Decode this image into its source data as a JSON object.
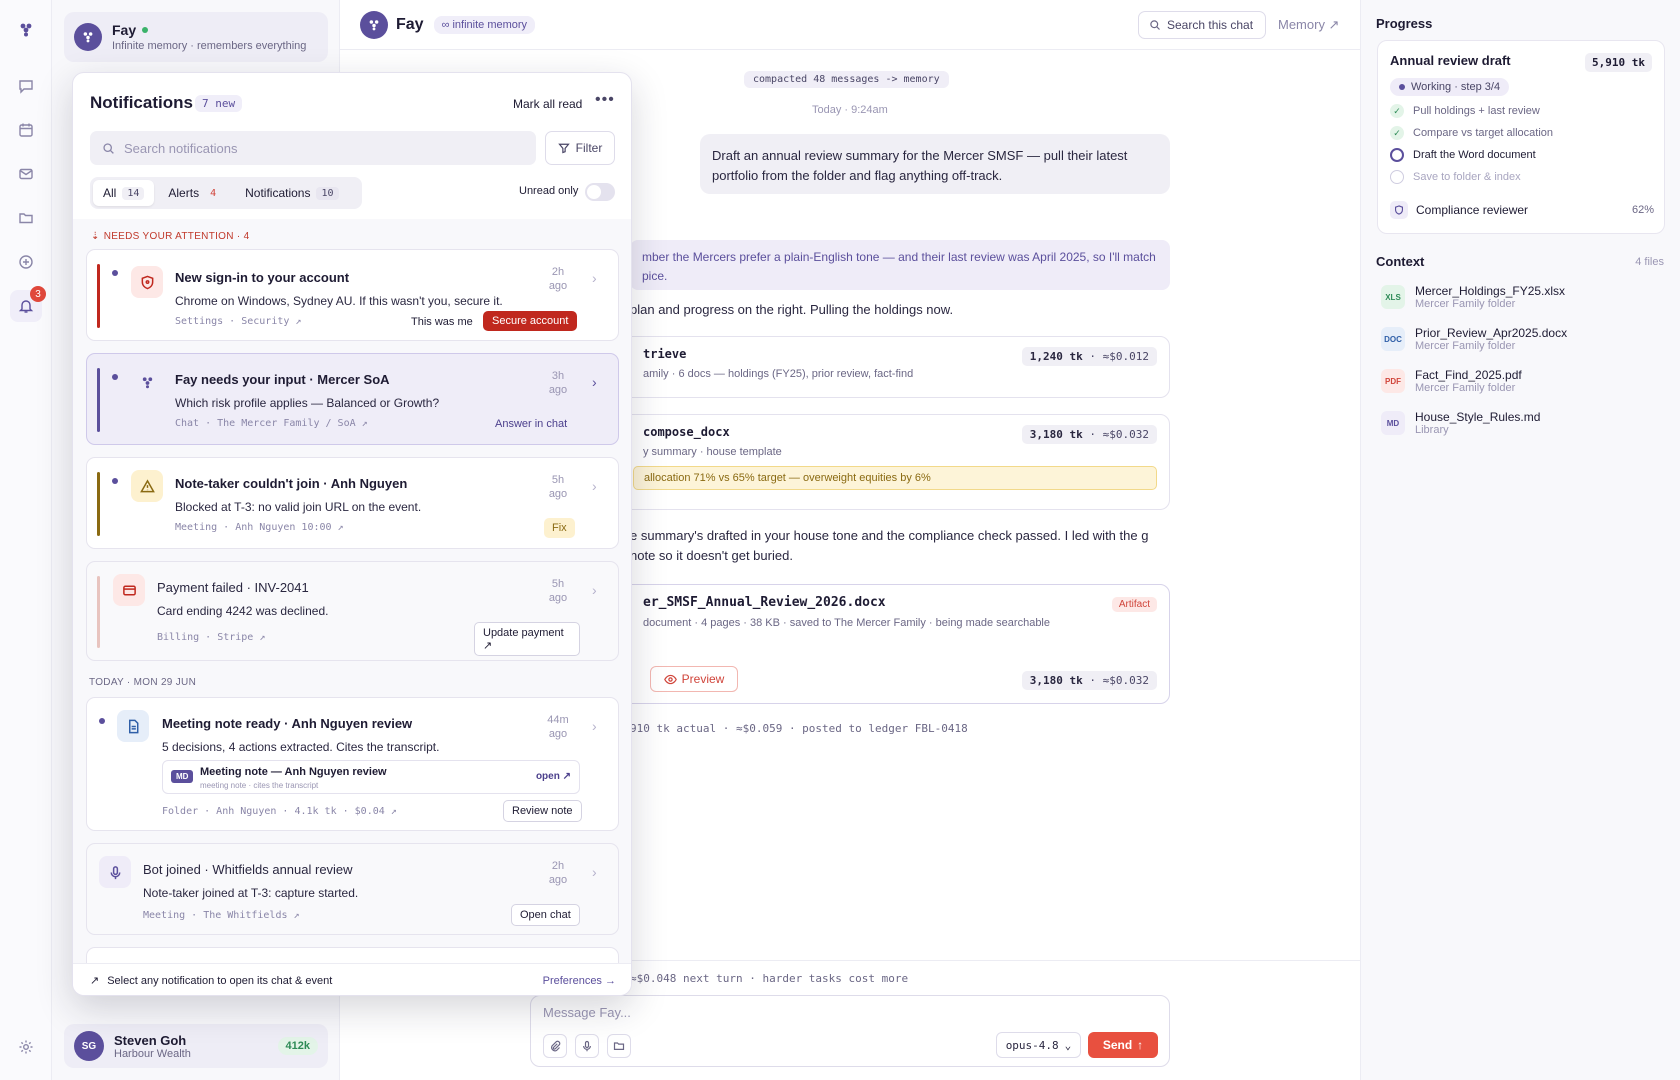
{
  "rail": {
    "notif_badge": "3"
  },
  "sidebar": {
    "agent_name": "Fay",
    "agent_sub": "Infinite memory · remembers everything",
    "user_initials": "SG",
    "user_name": "Steven Goh",
    "user_org": "Harbour Wealth",
    "credits": "412k"
  },
  "chat": {
    "title": "Fay",
    "memory_pill": "∞ infinite memory",
    "search_label": "Search this chat",
    "memory_link": "Memory ↗",
    "compacted": "compacted 48 messages -> memory",
    "timestamp": "Today · 9:24am",
    "user_message": "Draft an annual review summary for the Mercer SMSF — pull their latest portfolio from the folder and flag anything off-track.",
    "memory_note": "mber the Mercers prefer a plain-English tone — and their last review was April 2025, so I'll match pice.",
    "assist_1": "plan and progress on the right. Pulling the holdings now.",
    "tool1": {
      "name": "trieve",
      "desc": "amily · 6 docs — holdings (FY25), prior review, fact-find",
      "tk": "1,240 tk",
      "cost": "≈$0.012"
    },
    "tool2": {
      "name": "compose_docx",
      "desc": "y summary · house template",
      "tk": "3,180 tk",
      "cost": "≈$0.032",
      "warning": "allocation 71% vs 65% target — overweight equities by 6%"
    },
    "assist_2": "e summary's drafted in your house tone and the compliance check passed. I led with the g note so it doesn't get buried.",
    "artifact": {
      "name": "er_SMSF_Annual_Review_2026.docx",
      "tag": "Artifact",
      "meta": "document · 4 pages · 38 KB · saved to The Mercer Family · being made searchable",
      "preview": "Preview",
      "tk": "3,180 tk",
      "cost": "≈$0.032"
    },
    "ledger": "910 tk actual · ≈$0.059 · posted to ledger FBL-0418",
    "next_turn": "≈$0.048 next turn · harder tasks cost more",
    "composer_placeholder": "Message Fay...",
    "model": "opus-4.8",
    "send": "Send"
  },
  "progress": {
    "heading": "Progress",
    "title": "Annual review draft",
    "tk": "5,910 tk",
    "status": "Working · step 3/4",
    "steps": [
      "Pull holdings + last review",
      "Compare vs target allocation",
      "Draft the Word document",
      "Save to folder & index"
    ],
    "reviewer": "Compliance reviewer",
    "reviewer_pct": "62%"
  },
  "context": {
    "heading": "Context",
    "count": "4 files",
    "files": [
      {
        "badge": "XLS",
        "name": "Mercer_Holdings_FY25.xlsx",
        "sub": "Mercer Family folder"
      },
      {
        "badge": "DOC",
        "name": "Prior_Review_Apr2025.docx",
        "sub": "Mercer Family folder"
      },
      {
        "badge": "PDF",
        "name": "Fact_Find_2025.pdf",
        "sub": "Mercer Family folder"
      },
      {
        "badge": "MD",
        "name": "House_Style_Rules.md",
        "sub": "Library"
      }
    ]
  },
  "notifications": {
    "title": "Notifications",
    "new_count": "7 new",
    "mark_all": "Mark all read",
    "search_placeholder": "Search notifications",
    "filter": "Filter",
    "tabs": [
      {
        "label": "All",
        "count": "14"
      },
      {
        "label": "Alerts",
        "count": "4"
      },
      {
        "label": "Notifications",
        "count": "10"
      }
    ],
    "unread_only": "Unread only",
    "attention_header": "NEEDS YOUR ATTENTION · 4",
    "today_header": "TODAY · MON 29 JUN",
    "items": [
      {
        "title": "New sign-in to your account",
        "body": "Chrome on Windows, Sydney AU. If this wasn't you, secure it.",
        "meta": "Settings · Security ↗",
        "time": "2h ago",
        "action_secondary": "This was me",
        "action_primary": "Secure account"
      },
      {
        "title": "Fay needs your input · Mercer SoA",
        "body": "Which risk profile applies — Balanced or Growth?",
        "meta": "Chat · The Mercer Family / SoA ↗",
        "time": "3h ago",
        "action_primary": "Answer in chat"
      },
      {
        "title": "Note-taker couldn't join · Anh Nguyen",
        "body": "Blocked at T-3: no valid join URL on the event.",
        "meta": "Meeting · Anh Nguyen 10:00 ↗",
        "time": "5h ago",
        "action_primary": "Fix"
      },
      {
        "title": "Payment failed · INV-2041",
        "body": "Card ending 4242 was declined.",
        "meta": "Billing · Stripe ↗",
        "time": "5h ago",
        "action_primary": "Update payment ↗"
      },
      {
        "title": "Meeting note ready · Anh Nguyen review",
        "body": "5 decisions, 4 actions extracted. Cites the transcript.",
        "meta": "Folder · Anh Nguyen · 4.1k tk · $0.04 ↗",
        "time": "44m ago",
        "embed_title": "Meeting note — Anh Nguyen review",
        "embed_sub": "meeting note · cites the transcript",
        "embed_badge": "MD",
        "embed_open": "open ↗",
        "action_primary": "Review note"
      },
      {
        "title": "Bot joined · Whitfields annual review",
        "body": "Note-taker joined at T-3: capture started.",
        "meta": "Meeting · The Whitfields ↗",
        "time": "2h ago",
        "action_primary": "Open chat"
      }
    ],
    "footer_text": "Select any notification to open its chat & event",
    "preferences": "Preferences →"
  }
}
